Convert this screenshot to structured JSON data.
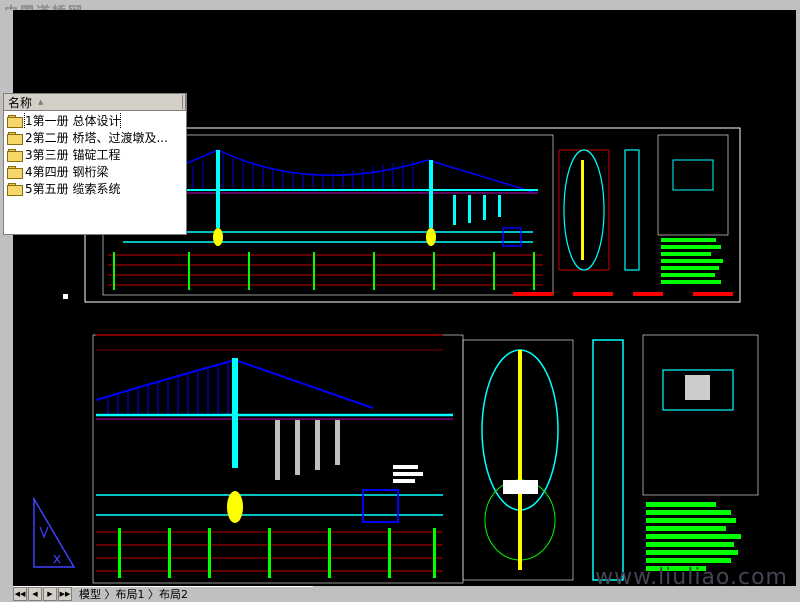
{
  "watermark": {
    "top_left": "中国道桥网",
    "bottom_right": "www.liuliao.com"
  },
  "file_panel": {
    "column_header": "名称",
    "items": [
      {
        "label": "1第一册 总体设计",
        "icon": "folder-icon",
        "selected": true
      },
      {
        "label": "2第二册 桥塔、过渡墩及...",
        "icon": "folder-icon",
        "selected": false
      },
      {
        "label": "3第三册 锚碇工程",
        "icon": "folder-icon",
        "selected": false
      },
      {
        "label": "4第四册 钢桁梁",
        "icon": "folder-icon",
        "selected": false
      },
      {
        "label": "5第五册 缆索系统",
        "icon": "folder-icon",
        "selected": false
      }
    ]
  },
  "layout_tabs": {
    "label": "模型 〉布局1 〉布局2"
  },
  "colors": {
    "canvas_bg": "#000000",
    "cable_blue": "#0000ff",
    "deck_cyan": "#00ffff",
    "dim_red": "#ff0000",
    "annot_green": "#00ff00",
    "border_white": "#ffffff",
    "magenta": "#ff00ff",
    "yellow": "#ffff00"
  }
}
